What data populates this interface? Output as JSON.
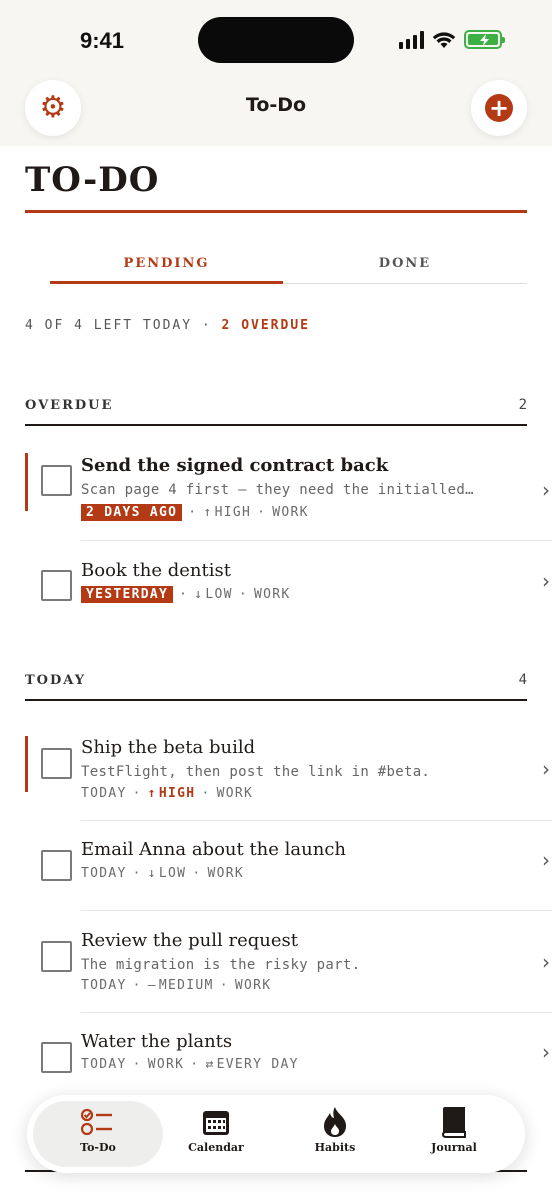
{
  "status_bar": {
    "time": "9:41"
  },
  "nav": {
    "title": "To-Do",
    "settings_icon": "gear-icon",
    "add_icon": "plus-circle-icon"
  },
  "header": {
    "title": "TO-DO"
  },
  "tabs": {
    "pending": "PENDING",
    "done": "DONE",
    "active": "PENDING"
  },
  "summary": {
    "left_text": "4 OF 4 LEFT TODAY",
    "separator": "·",
    "overdue_text": "2 OVERDUE"
  },
  "sections": {
    "overdue": {
      "label": "OVERDUE",
      "count": "2",
      "tasks": [
        {
          "title": "Send the signed contract back",
          "note": "Scan page 4 first — they need the initialled…",
          "badge": "2 DAYS AGO",
          "priority_icon": "↑",
          "priority": "HIGH",
          "project": "WORK"
        },
        {
          "title": "Book the dentist",
          "badge": "YESTERDAY",
          "priority_icon": "↓",
          "priority": "LOW",
          "project": "WORK"
        }
      ]
    },
    "today": {
      "label": "TODAY",
      "count": "4",
      "tasks": [
        {
          "title": "Ship the beta build",
          "note": "TestFlight, then post the link in #beta.",
          "due": "TODAY",
          "priority_icon": "↑",
          "priority": "HIGH",
          "project": "WORK"
        },
        {
          "title": "Email Anna about the launch",
          "due": "TODAY",
          "priority_icon": "↓",
          "priority": "LOW",
          "project": "WORK"
        },
        {
          "title": "Review the pull request",
          "note": "The migration is the risky part.",
          "due": "TODAY",
          "priority_icon": "—",
          "priority": "MEDIUM",
          "project": "WORK"
        },
        {
          "title": "Water the plants",
          "due": "TODAY",
          "project": "WORK",
          "repeat_icon": "⇄",
          "repeat": "EVERY DAY"
        }
      ]
    }
  },
  "tab_bar": {
    "items": [
      {
        "label": "To-Do",
        "icon": "checklist-icon",
        "active": true
      },
      {
        "label": "Calendar",
        "icon": "calendar-icon"
      },
      {
        "label": "Habits",
        "icon": "flame-icon"
      },
      {
        "label": "Journal",
        "icon": "book-icon"
      }
    ]
  },
  "colors": {
    "accent": "#b33a14",
    "text": "#1f1a17",
    "battery": "#3cb043"
  }
}
